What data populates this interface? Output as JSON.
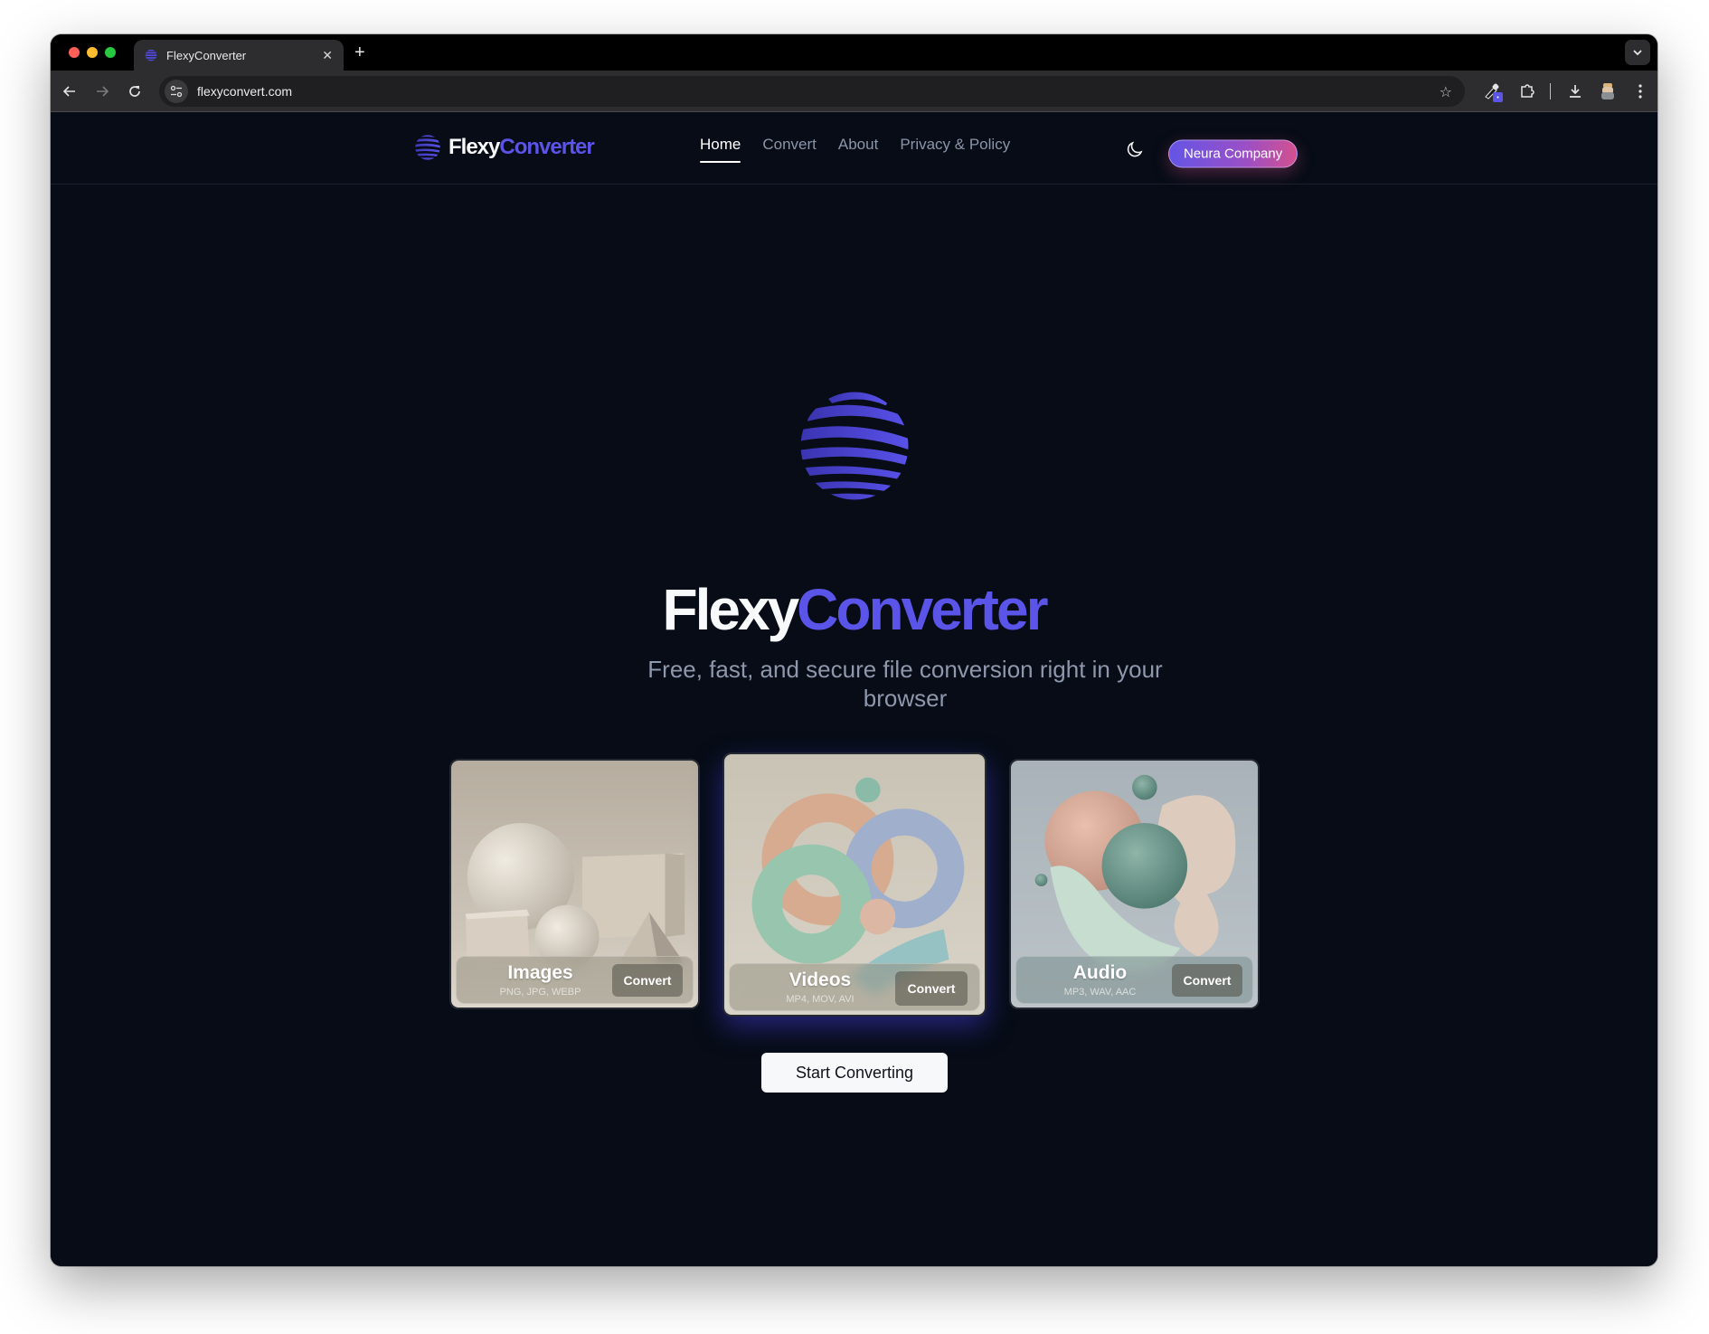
{
  "browser": {
    "tab_title": "FlexyConverter",
    "url": "flexyconvert.com",
    "icons": {
      "back": "arrow-left-icon",
      "forward": "arrow-right-icon",
      "reload": "reload-icon",
      "site_info": "tune-icon",
      "bookmark": "star-icon",
      "extension": "eyedropper-icon",
      "extensions": "puzzle-icon",
      "downloads": "download-icon",
      "profile": "avatar-icon",
      "menu": "kebab-menu-icon"
    }
  },
  "header": {
    "brand_part1": "Flexy",
    "brand_part2": "Converter",
    "nav": [
      {
        "label": "Home",
        "active": true
      },
      {
        "label": "Convert",
        "active": false
      },
      {
        "label": "About",
        "active": false
      },
      {
        "label": "Privacy & Policy",
        "active": false
      }
    ],
    "theme_toggle_icon": "moon-icon",
    "company_button": "Neura Company"
  },
  "hero": {
    "title_part1": "Flexy",
    "title_part2": "Converter",
    "subtitle": "Free, fast, and secure file conversion right in your browser",
    "cards": [
      {
        "title": "Images",
        "formats": "PNG, JPG, WEBP",
        "button": "Convert"
      },
      {
        "title": "Videos",
        "formats": "MP4, MOV, AVI",
        "button": "Convert"
      },
      {
        "title": "Audio",
        "formats": "MP3, WAV, AAC",
        "button": "Convert"
      }
    ],
    "cta": "Start Converting"
  },
  "colors": {
    "background": "#070c16",
    "brand_accent": "#5b54e8",
    "nav_text": "#8b95a8",
    "pill_gradient_start": "#6455e6",
    "pill_gradient_end": "#d2508f"
  }
}
